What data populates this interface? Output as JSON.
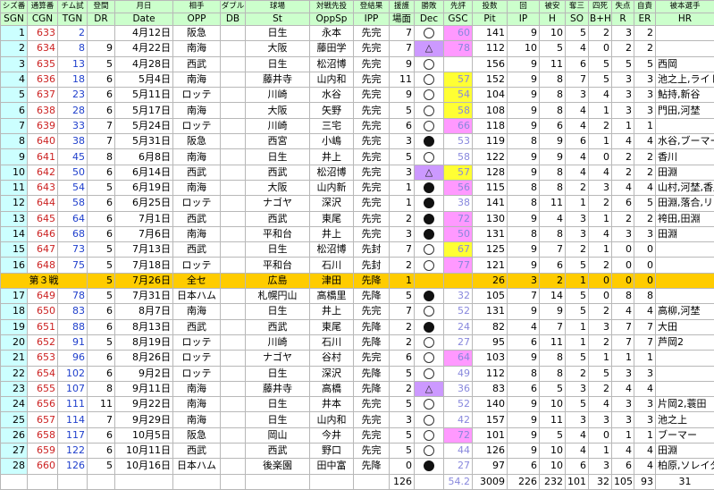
{
  "header": {
    "jp": [
      "シズ番",
      "通算番",
      "チム試",
      "登間",
      "月日",
      "相手",
      "ダブル",
      "球場",
      "対戦先投",
      "登結果",
      "援護",
      "勝敗",
      "先評",
      "投数",
      "回",
      "被安",
      "奪三",
      "四死",
      "失点",
      "自責",
      "被本選手"
    ],
    "en": [
      "SGN",
      "CGN",
      "TGN",
      "DR",
      "Date",
      "OPP",
      "DB",
      "St",
      "OppSp",
      "IPP",
      "場面",
      "Dec",
      "GSC",
      "Pit",
      "IP",
      "H",
      "SO",
      "B+H",
      "R",
      "ER",
      "HR"
    ]
  },
  "rows": [
    {
      "sgn": "1",
      "cgn": "633",
      "tgn": "2",
      "dr": "",
      "date": "4月12日",
      "opp": "阪急",
      "db": "",
      "st": "日生",
      "oppsp": "永本",
      "ipp": "先完",
      "ba": "7",
      "dec": "white",
      "gsc": "60",
      "gsc_color": "pink",
      "pit": "141",
      "ip": "9",
      "h": "10",
      "so": "5",
      "bh": "2",
      "r": "3",
      "er": "2",
      "hr": ""
    },
    {
      "sgn": "2",
      "cgn": "634",
      "tgn": "8",
      "dr": "9",
      "date": "4月22日",
      "opp": "南海",
      "db": "",
      "st": "大阪",
      "oppsp": "藤田学",
      "ipp": "先完",
      "ba": "7",
      "dec": "tri",
      "gsc": "78",
      "gsc_color": "pink",
      "pit": "112",
      "ip": "10",
      "h": "5",
      "so": "4",
      "bh": "0",
      "r": "2",
      "er": "2",
      "hr": ""
    },
    {
      "sgn": "3",
      "cgn": "635",
      "tgn": "13",
      "dr": "5",
      "date": "4月28日",
      "opp": "西武",
      "db": "",
      "st": "日生",
      "oppsp": "松沼博",
      "ipp": "先完",
      "ba": "9",
      "dec": "white",
      "gsc": "",
      "gsc_color": "plain",
      "pit": "156",
      "ip": "9",
      "h": "11",
      "so": "6",
      "bh": "5",
      "r": "5",
      "er": "5",
      "hr": "西岡"
    },
    {
      "sgn": "4",
      "cgn": "636",
      "tgn": "18",
      "dr": "6",
      "date": "5月4日",
      "opp": "南海",
      "db": "",
      "st": "藤井寺",
      "oppsp": "山内和",
      "ipp": "先完",
      "ba": "11",
      "dec": "white",
      "gsc": "57",
      "gsc_color": "yellow",
      "pit": "152",
      "ip": "9",
      "h": "8",
      "so": "7",
      "bh": "5",
      "r": "3",
      "er": "3",
      "hr": "池之上,ライトル"
    },
    {
      "sgn": "5",
      "cgn": "637",
      "tgn": "23",
      "dr": "6",
      "date": "5月11日",
      "opp": "ロッテ",
      "db": "",
      "st": "川崎",
      "oppsp": "水谷",
      "ipp": "先完",
      "ba": "9",
      "dec": "white",
      "gsc": "54",
      "gsc_color": "yellow",
      "pit": "104",
      "ip": "9",
      "h": "8",
      "so": "3",
      "bh": "4",
      "r": "3",
      "er": "3",
      "hr": "鮎持,新谷"
    },
    {
      "sgn": "6",
      "cgn": "638",
      "tgn": "28",
      "dr": "6",
      "date": "5月17日",
      "opp": "南海",
      "db": "",
      "st": "大阪",
      "oppsp": "矢野",
      "ipp": "先完",
      "ba": "5",
      "dec": "white",
      "gsc": "58",
      "gsc_color": "yellow",
      "pit": "108",
      "ip": "9",
      "h": "8",
      "so": "4",
      "bh": "1",
      "r": "3",
      "er": "3",
      "hr": "門田,河埜"
    },
    {
      "sgn": "7",
      "cgn": "639",
      "tgn": "33",
      "dr": "7",
      "date": "5月24日",
      "opp": "ロッテ",
      "db": "",
      "st": "川崎",
      "oppsp": "三宅",
      "ipp": "先完",
      "ba": "6",
      "dec": "white",
      "gsc": "66",
      "gsc_color": "pink",
      "pit": "118",
      "ip": "9",
      "h": "6",
      "so": "4",
      "bh": "2",
      "r": "1",
      "er": "1",
      "hr": ""
    },
    {
      "sgn": "8",
      "cgn": "640",
      "tgn": "38",
      "dr": "7",
      "date": "5月31日",
      "opp": "阪急",
      "db": "",
      "st": "西宮",
      "oppsp": "小嶋",
      "ipp": "先完",
      "ba": "3",
      "dec": "black",
      "gsc": "53",
      "gsc_color": "plain",
      "pit": "119",
      "ip": "8",
      "h": "9",
      "so": "6",
      "bh": "1",
      "r": "4",
      "er": "4",
      "hr": "水谷,ブーマー"
    },
    {
      "sgn": "9",
      "cgn": "641",
      "tgn": "45",
      "dr": "8",
      "date": "6月8日",
      "opp": "南海",
      "db": "",
      "st": "日生",
      "oppsp": "井上",
      "ipp": "先完",
      "ba": "5",
      "dec": "white",
      "gsc": "58",
      "gsc_color": "plain",
      "pit": "122",
      "ip": "9",
      "h": "9",
      "so": "4",
      "bh": "0",
      "r": "2",
      "er": "2",
      "hr": "香川"
    },
    {
      "sgn": "10",
      "cgn": "642",
      "tgn": "50",
      "dr": "6",
      "date": "6月14日",
      "opp": "西武",
      "db": "",
      "st": "西武",
      "oppsp": "松沼博",
      "ipp": "先完",
      "ba": "3",
      "dec": "tri",
      "gsc": "57",
      "gsc_color": "yellow",
      "pit": "128",
      "ip": "9",
      "h": "8",
      "so": "4",
      "bh": "4",
      "r": "2",
      "er": "2",
      "hr": "田淵"
    },
    {
      "sgn": "11",
      "cgn": "643",
      "tgn": "54",
      "dr": "5",
      "date": "6月19日",
      "opp": "南海",
      "db": "",
      "st": "大阪",
      "oppsp": "山内新",
      "ipp": "先完",
      "ba": "1",
      "dec": "black",
      "gsc": "56",
      "gsc_color": "pink",
      "pit": "115",
      "ip": "8",
      "h": "8",
      "so": "2",
      "bh": "3",
      "r": "4",
      "er": "4",
      "hr": "山村,河埜,香川"
    },
    {
      "sgn": "12",
      "cgn": "644",
      "tgn": "58",
      "dr": "6",
      "date": "6月25日",
      "opp": "ロッテ",
      "db": "",
      "st": "ナゴヤ",
      "oppsp": "深沢",
      "ipp": "先完",
      "ba": "1",
      "dec": "black",
      "gsc": "38",
      "gsc_color": "plain",
      "pit": "141",
      "ip": "8",
      "h": "11",
      "so": "1",
      "bh": "2",
      "r": "6",
      "er": "5",
      "hr": "田淵,落合,リー"
    },
    {
      "sgn": "13",
      "cgn": "645",
      "tgn": "64",
      "dr": "6",
      "date": "7月1日",
      "opp": "西武",
      "db": "",
      "st": "西武",
      "oppsp": "東尾",
      "ipp": "先完",
      "ba": "2",
      "dec": "black",
      "gsc": "72",
      "gsc_color": "pink",
      "pit": "130",
      "ip": "9",
      "h": "4",
      "so": "3",
      "bh": "1",
      "r": "2",
      "er": "2",
      "hr": "袴田,田淵"
    },
    {
      "sgn": "14",
      "cgn": "646",
      "tgn": "68",
      "dr": "6",
      "date": "7月6日",
      "opp": "南海",
      "db": "",
      "st": "平和台",
      "oppsp": "井上",
      "ipp": "先完",
      "ba": "3",
      "dec": "black",
      "gsc": "50",
      "gsc_color": "pink",
      "pit": "131",
      "ip": "8",
      "h": "8",
      "so": "3",
      "bh": "4",
      "r": "3",
      "er": "3",
      "hr": "田淵"
    },
    {
      "sgn": "15",
      "cgn": "647",
      "tgn": "73",
      "dr": "5",
      "date": "7月13日",
      "opp": "西武",
      "db": "",
      "st": "日生",
      "oppsp": "松沼博",
      "ipp": "先封",
      "ba": "7",
      "dec": "white",
      "gsc": "67",
      "gsc_color": "yellow",
      "pit": "125",
      "ip": "9",
      "h": "7",
      "so": "2",
      "bh": "1",
      "r": "0",
      "er": "0",
      "hr": ""
    },
    {
      "sgn": "16",
      "cgn": "648",
      "tgn": "75",
      "dr": "5",
      "date": "7月18日",
      "opp": "ロッテ",
      "db": "",
      "st": "平和台",
      "oppsp": "石川",
      "ipp": "先封",
      "ba": "2",
      "dec": "white",
      "gsc": "77",
      "gsc_color": "pink",
      "pit": "121",
      "ip": "9",
      "h": "6",
      "so": "5",
      "bh": "2",
      "r": "0",
      "er": "0",
      "hr": ""
    }
  ],
  "allstar": {
    "label": "第３戦",
    "dr": "5",
    "date": "7月26日",
    "opp": "全セ",
    "st": "広島",
    "oppsp": "津田",
    "ipp": "先降",
    "ba": "1",
    "pit": "26",
    "ip": "3",
    "h": "2",
    "so": "1",
    "bh": "0",
    "r": "0",
    "er": "0"
  },
  "rows2": [
    {
      "sgn": "17",
      "cgn": "649",
      "tgn": "78",
      "dr": "5",
      "date": "7月31日",
      "opp": "日本ハム",
      "db": "",
      "st": "札幌円山",
      "oppsp": "高橋里",
      "ipp": "先降",
      "ba": "5",
      "dec": "black",
      "gsc": "32",
      "gsc_color": "plain",
      "pit": "105",
      "ip": "7",
      "h": "14",
      "so": "5",
      "bh": "0",
      "r": "8",
      "er": "8",
      "hr": ""
    },
    {
      "sgn": "18",
      "cgn": "650",
      "tgn": "83",
      "dr": "6",
      "date": "8月7日",
      "opp": "南海",
      "db": "",
      "st": "日生",
      "oppsp": "井上",
      "ipp": "先完",
      "ba": "7",
      "dec": "white",
      "gsc": "52",
      "gsc_color": "plain",
      "pit": "131",
      "ip": "9",
      "h": "9",
      "so": "5",
      "bh": "2",
      "r": "4",
      "er": "4",
      "hr": "高柳,河埜"
    },
    {
      "sgn": "19",
      "cgn": "651",
      "tgn": "88",
      "dr": "6",
      "date": "8月13日",
      "opp": "西武",
      "db": "",
      "st": "西武",
      "oppsp": "東尾",
      "ipp": "先降",
      "ba": "2",
      "dec": "black",
      "gsc": "24",
      "gsc_color": "plain",
      "pit": "82",
      "ip": "4",
      "h": "7",
      "so": "1",
      "bh": "3",
      "r": "7",
      "er": "7",
      "hr": "大田"
    },
    {
      "sgn": "20",
      "cgn": "652",
      "tgn": "91",
      "dr": "5",
      "date": "8月19日",
      "opp": "ロッテ",
      "db": "",
      "st": "川崎",
      "oppsp": "石川",
      "ipp": "先降",
      "ba": "2",
      "dec": "white",
      "gsc": "27",
      "gsc_color": "plain",
      "pit": "95",
      "ip": "6",
      "h": "11",
      "so": "1",
      "bh": "2",
      "r": "7",
      "er": "7",
      "hr": "芦岡2"
    },
    {
      "sgn": "21",
      "cgn": "653",
      "tgn": "96",
      "dr": "6",
      "date": "8月26日",
      "opp": "ロッテ",
      "db": "",
      "st": "ナゴヤ",
      "oppsp": "谷村",
      "ipp": "先完",
      "ba": "6",
      "dec": "white",
      "gsc": "64",
      "gsc_color": "pink",
      "pit": "103",
      "ip": "9",
      "h": "8",
      "so": "5",
      "bh": "1",
      "r": "1",
      "er": "1",
      "hr": ""
    },
    {
      "sgn": "22",
      "cgn": "654",
      "tgn": "102",
      "dr": "6",
      "date": "9月2日",
      "opp": "ロッテ",
      "db": "",
      "st": "日生",
      "oppsp": "深沢",
      "ipp": "先降",
      "ba": "5",
      "dec": "white",
      "gsc": "49",
      "gsc_color": "plain",
      "pit": "112",
      "ip": "8",
      "h": "8",
      "so": "2",
      "bh": "5",
      "r": "3",
      "er": "3",
      "hr": ""
    },
    {
      "sgn": "23",
      "cgn": "655",
      "tgn": "107",
      "dr": "8",
      "date": "9月11日",
      "opp": "南海",
      "db": "",
      "st": "藤井寺",
      "oppsp": "高橋",
      "ipp": "先降",
      "ba": "2",
      "dec": "tri",
      "gsc": "36",
      "gsc_color": "plain",
      "pit": "83",
      "ip": "6",
      "h": "5",
      "so": "3",
      "bh": "2",
      "r": "4",
      "er": "4",
      "hr": ""
    },
    {
      "sgn": "24",
      "cgn": "656",
      "tgn": "111",
      "dr": "11",
      "date": "9月22日",
      "opp": "南海",
      "db": "",
      "st": "日生",
      "oppsp": "井本",
      "ipp": "先完",
      "ba": "5",
      "dec": "white",
      "gsc": "52",
      "gsc_color": "plain",
      "pit": "140",
      "ip": "9",
      "h": "10",
      "so": "5",
      "bh": "4",
      "r": "3",
      "er": "3",
      "hr": "片岡2,蓑田"
    },
    {
      "sgn": "25",
      "cgn": "657",
      "tgn": "114",
      "dr": "7",
      "date": "9月29日",
      "opp": "南海",
      "db": "",
      "st": "日生",
      "oppsp": "山内和",
      "ipp": "先完",
      "ba": "3",
      "dec": "white",
      "gsc": "42",
      "gsc_color": "plain",
      "pit": "157",
      "ip": "9",
      "h": "11",
      "so": "3",
      "bh": "3",
      "r": "3",
      "er": "3",
      "hr": "池之上"
    },
    {
      "sgn": "26",
      "cgn": "658",
      "tgn": "117",
      "dr": "6",
      "date": "10月5日",
      "opp": "阪急",
      "db": "",
      "st": "岡山",
      "oppsp": "今井",
      "ipp": "先完",
      "ba": "5",
      "dec": "white",
      "gsc": "72",
      "gsc_color": "pink",
      "pit": "101",
      "ip": "9",
      "h": "5",
      "so": "4",
      "bh": "0",
      "r": "1",
      "er": "1",
      "hr": "ブーマー"
    },
    {
      "sgn": "27",
      "cgn": "659",
      "tgn": "122",
      "dr": "6",
      "date": "10月11日",
      "opp": "西武",
      "db": "",
      "st": "西武",
      "oppsp": "野口",
      "ipp": "先完",
      "ba": "5",
      "dec": "white",
      "gsc": "44",
      "gsc_color": "plain",
      "pit": "126",
      "ip": "9",
      "h": "10",
      "so": "4",
      "bh": "1",
      "r": "4",
      "er": "4",
      "hr": "田淵"
    },
    {
      "sgn": "28",
      "cgn": "660",
      "tgn": "126",
      "dr": "5",
      "date": "10月16日",
      "opp": "日本ハム",
      "db": "",
      "st": "後楽園",
      "oppsp": "田中富",
      "ipp": "先降",
      "ba": "0",
      "dec": "black",
      "gsc": "27",
      "gsc_color": "plain",
      "pit": "97",
      "ip": "6",
      "h": "10",
      "so": "6",
      "bh": "3",
      "r": "6",
      "er": "4",
      "hr": "柏原,ソレイタ"
    }
  ],
  "totals": {
    "ba": "126",
    "gsc": "54.2",
    "pit": "3009",
    "ip": "226",
    "h": "232",
    "so": "101",
    "bh": "32",
    "r": "105",
    "er": "93",
    "hr": "31"
  }
}
